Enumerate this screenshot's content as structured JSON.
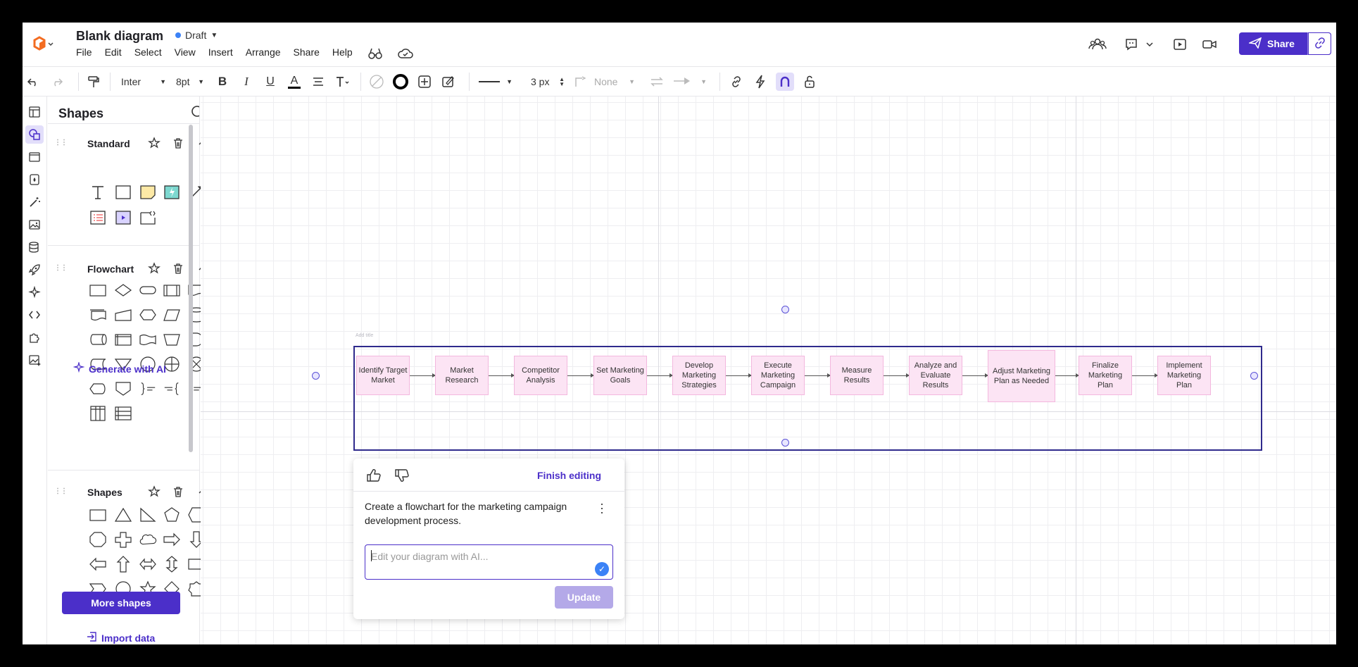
{
  "header": {
    "title": "Blank diagram",
    "status": "Draft",
    "menu": [
      "File",
      "Edit",
      "Select",
      "View",
      "Insert",
      "Arrange",
      "Share",
      "Help"
    ],
    "share_label": "Share"
  },
  "toolbar": {
    "font": "Inter",
    "font_size": "8pt",
    "line_width": "3 px",
    "arrow_none": "None"
  },
  "panel": {
    "title": "Shapes",
    "sections": [
      {
        "name": "Standard"
      },
      {
        "name": "Flowchart"
      },
      {
        "name": "Shapes"
      }
    ],
    "generate_ai": "Generate with AI",
    "more_shapes": "More shapes",
    "import_data": "Import data"
  },
  "canvas": {
    "add_title": "Add title",
    "flow_steps": [
      "Identify Target Market",
      "Market Research",
      "Competitor Analysis",
      "Set Marketing Goals",
      "Develop Marketing Strategies",
      "Execute Marketing Campaign",
      "Measure Results",
      "Analyze and Evaluate Results",
      "Adjust Marketing Plan as Needed",
      "Finalize Marketing Plan",
      "Implement Marketing Plan"
    ]
  },
  "ai_popup": {
    "finish_label": "Finish editing",
    "prompt": "Create a flowchart for the marketing campaign development process.",
    "input_placeholder": "Edit your diagram with AI...",
    "update_label": "Update"
  },
  "colors": {
    "accent": "#4b2fc9",
    "box_fill": "#fce4f4",
    "box_border": "#f3b7de",
    "frame": "#2f2a8c"
  }
}
